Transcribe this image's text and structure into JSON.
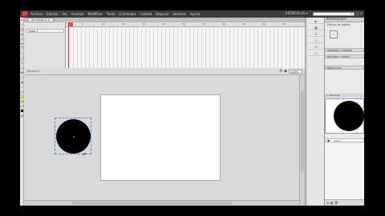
{
  "menu": {
    "logo": "Fl",
    "items": [
      "Archivo",
      "Edición",
      "Ver",
      "Insertar",
      "Modificar",
      "Texto",
      "Comandos",
      "Control",
      "Depurar",
      "Ventana",
      "Ayuda"
    ],
    "workspace": "ESENCIALES ▾",
    "window_controls": "— □ ✕"
  },
  "document": {
    "tab_label": "Sin título-1 ×"
  },
  "timeline": {
    "layer_name": "Capa 1",
    "ruler": [
      "5",
      "10",
      "15",
      "20",
      "25",
      "30",
      "35",
      "40",
      "45",
      "50",
      "55",
      "60",
      "65",
      "70",
      "75",
      "80",
      "85"
    ],
    "status": "1  24.00fps  0.0s"
  },
  "stage": {
    "scene": "Escena 1",
    "zoom": "100%"
  },
  "properties": {
    "header": "PROPIEDADES",
    "object_type": "Dibujo de objeto",
    "position_label": "POSICIÓN Y TAMAÑO",
    "fill_label": "RELLENO Y TRAZO"
  },
  "library": {
    "header": "BIBLIOTECA",
    "doc_name": "Sin título-1",
    "item_count": "1 elemento",
    "item_name": "Sím 1"
  },
  "colors": {
    "menubar": "#3c3c3c",
    "logo": "#b8302b",
    "playhead": "#dd3333",
    "stage": "#ffffff",
    "shape_fill": "#000000"
  }
}
